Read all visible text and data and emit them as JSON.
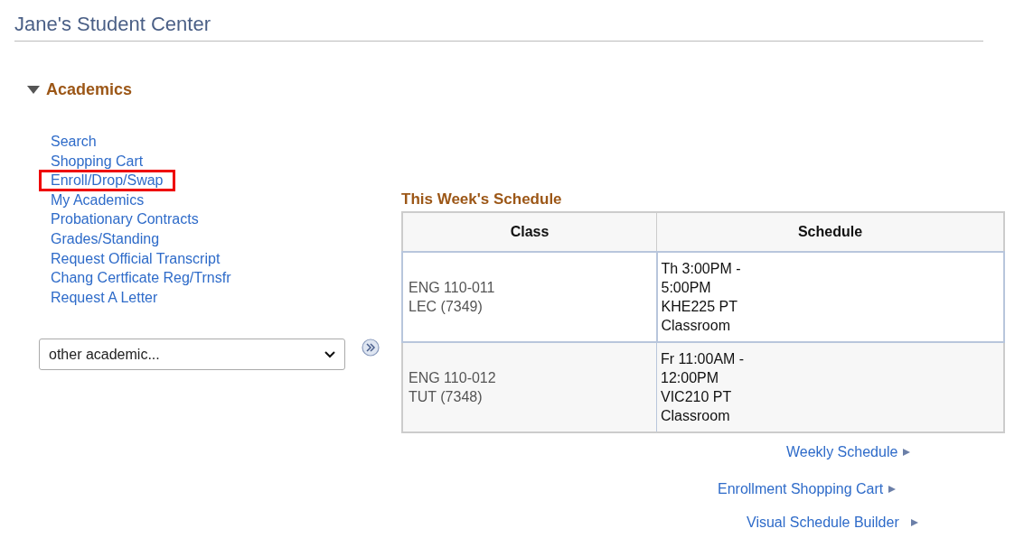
{
  "page_title": "Jane's Student Center",
  "section": {
    "title": "Academics",
    "expanded": true
  },
  "links": [
    {
      "label": "Search",
      "highlighted": false
    },
    {
      "label": "Shopping Cart",
      "highlighted": false
    },
    {
      "label": "Enroll/Drop/Swap",
      "highlighted": true
    },
    {
      "label": "My Academics",
      "highlighted": false
    },
    {
      "label": "Probationary Contracts",
      "highlighted": false
    },
    {
      "label": "Grades/Standing",
      "highlighted": false
    },
    {
      "label": "Request Official Transcript",
      "highlighted": false
    },
    {
      "label": "Chang Certficate Reg/Trnsfr",
      "highlighted": false
    },
    {
      "label": "Request A Letter",
      "highlighted": false
    }
  ],
  "other_select": {
    "value": "other academic..."
  },
  "schedule": {
    "title": "This Week's Schedule",
    "columns": [
      "Class",
      "Schedule"
    ],
    "rows": [
      {
        "class": [
          "ENG 110-011",
          "LEC (7349)"
        ],
        "schedule": [
          "Th 3:00PM -",
          "5:00PM",
          "KHE225 PT",
          "Classroom"
        ],
        "selected": true
      },
      {
        "class": [
          "ENG 110-012",
          "TUT (7348)"
        ],
        "schedule": [
          "Fr 11:00AM -",
          "12:00PM",
          "VIC210 PT",
          "Classroom"
        ],
        "selected": false
      }
    ]
  },
  "footer_links": [
    "Weekly Schedule",
    "Enrollment Shopping Cart",
    "Visual Schedule Builder"
  ]
}
